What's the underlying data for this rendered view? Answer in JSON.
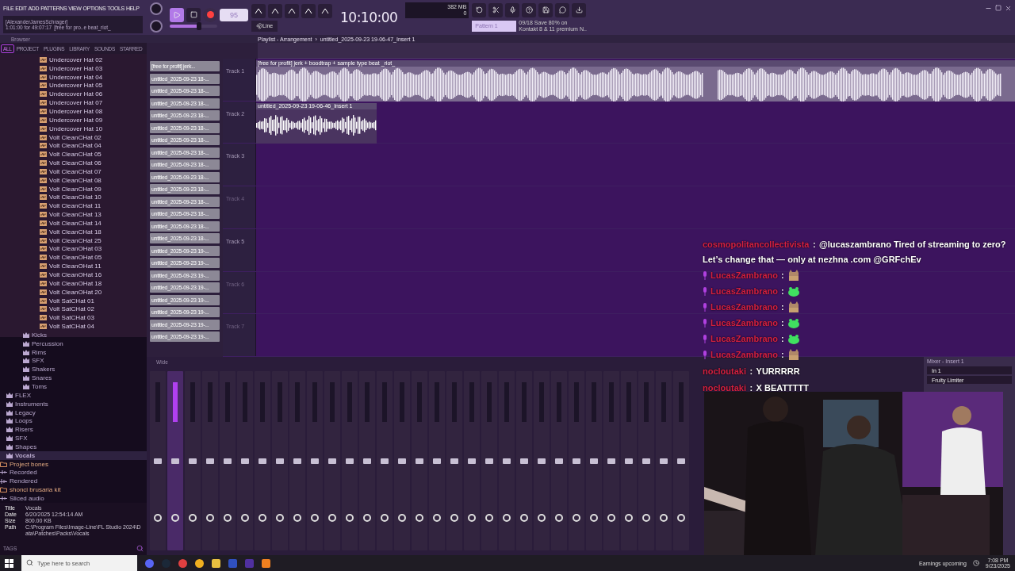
{
  "menu": [
    "FILE",
    "EDIT",
    "ADD",
    "PATTERNS",
    "VIEW",
    "OPTIONS",
    "TOOLS",
    "HELP"
  ],
  "hint": {
    "line1": "[AlexanderJamesSchrager]",
    "line2": "1:01:00 for 49:07:17",
    "line3": "[free for pro..e beat_riot_"
  },
  "transport": {
    "master": {
      "level": 0.62
    },
    "playing": false,
    "recording": true,
    "tempo": "95",
    "time": "10:10:00",
    "memory": "382 MB",
    "cpu": "0",
    "snap": "Line",
    "pattern": "Pattern 1"
  },
  "news": {
    "line1": "09/18  Save 80% on",
    "line2": "Kontakt 8 & 11 premium N.."
  },
  "browser": {
    "title": "Browser",
    "tabs": [
      {
        "label": "ALL",
        "selected": true
      },
      {
        "label": "PROJECT",
        "selected": false
      },
      {
        "label": "PLUGINS",
        "selected": false
      },
      {
        "label": "LIBRARY",
        "selected": false
      },
      {
        "label": "SOUNDS",
        "selected": false
      },
      {
        "label": "STARRED",
        "selected": false
      }
    ],
    "tree": [
      {
        "children": [
          {
            "children": [
              {
                "children": [
                  {
                    "label": "Undercover Hat 02",
                    "kind": "sample"
                  },
                  {
                    "label": "Undercover Hat 03",
                    "kind": "sample"
                  },
                  {
                    "label": "Undercover Hat 04",
                    "kind": "sample"
                  },
                  {
                    "label": "Undercover Hat 05",
                    "kind": "sample"
                  },
                  {
                    "label": "Undercover Hat 06",
                    "kind": "sample"
                  },
                  {
                    "label": "Undercover Hat 07",
                    "kind": "sample"
                  },
                  {
                    "label": "Undercover Hat 08",
                    "kind": "sample"
                  },
                  {
                    "label": "Undercover Hat 09",
                    "kind": "sample"
                  },
                  {
                    "label": "Undercover Hat 10",
                    "kind": "sample"
                  },
                  {
                    "label": "Volt CleanCHat 02",
                    "kind": "sample"
                  },
                  {
                    "label": "Volt CleanCHat 04",
                    "kind": "sample"
                  },
                  {
                    "label": "Volt CleanCHat 05",
                    "kind": "sample"
                  },
                  {
                    "label": "Volt CleanCHat 06",
                    "kind": "sample"
                  },
                  {
                    "label": "Volt CleanCHat 07",
                    "kind": "sample"
                  },
                  {
                    "label": "Volt CleanCHat 08",
                    "kind": "sample"
                  },
                  {
                    "label": "Volt CleanCHat 09",
                    "kind": "sample"
                  },
                  {
                    "label": "Volt CleanCHat 10",
                    "kind": "sample"
                  },
                  {
                    "label": "Volt CleanCHat 11",
                    "kind": "sample"
                  },
                  {
                    "label": "Volt CleanCHat 13",
                    "kind": "sample"
                  },
                  {
                    "label": "Volt CleanCHat 14",
                    "kind": "sample"
                  },
                  {
                    "label": "Volt CleanCHat 18",
                    "kind": "sample"
                  },
                  {
                    "label": "Volt CleanCHat 25",
                    "kind": "sample"
                  },
                  {
                    "label": "Volt CleanOHat 03",
                    "kind": "sample"
                  },
                  {
                    "label": "Volt CleanOHat 05",
                    "kind": "sample"
                  },
                  {
                    "label": "Volt CleanOHat 11",
                    "kind": "sample"
                  },
                  {
                    "label": "Volt CleanOHat 16",
                    "kind": "sample"
                  },
                  {
                    "label": "Volt CleanOHat 18",
                    "kind": "sample"
                  },
                  {
                    "label": "Volt CleanOHat 20",
                    "kind": "sample"
                  },
                  {
                    "label": "Volt SatCHat 01",
                    "kind": "sample"
                  },
                  {
                    "label": "Volt SatCHat 02",
                    "kind": "sample"
                  },
                  {
                    "label": "Volt SatCHat 03",
                    "kind": "sample"
                  },
                  {
                    "label": "Volt SatCHat 04",
                    "kind": "sample"
                  }
                ]
              },
              {
                "label": "Kicks",
                "kind": "pack",
                "selected": false
              },
              {
                "label": "Percussion",
                "kind": "pack",
                "selected": false
              },
              {
                "label": "Rims",
                "kind": "pack",
                "selected": false
              },
              {
                "label": "SFX",
                "kind": "pack",
                "selected": false
              },
              {
                "label": "Shakers",
                "kind": "pack",
                "selected": false
              },
              {
                "label": "Snares",
                "kind": "pack",
                "selected": false
              },
              {
                "label": "Toms",
                "kind": "pack",
                "selected": false
              }
            ]
          },
          {
            "label": "FLEX",
            "kind": "pack",
            "selected": false
          },
          {
            "label": "Instruments",
            "kind": "pack",
            "selected": false
          },
          {
            "label": "Legacy",
            "kind": "pack",
            "selected": false
          },
          {
            "label": "Loops",
            "kind": "pack",
            "selected": false
          },
          {
            "label": "Risers",
            "kind": "pack",
            "selected": false
          },
          {
            "label": "SFX",
            "kind": "pack",
            "selected": false
          },
          {
            "label": "Shapes",
            "kind": "pack",
            "selected": false
          },
          {
            "label": "Vocals",
            "kind": "pack",
            "selected": true
          }
        ]
      },
      {
        "label": "Project bones",
        "kind": "folder",
        "selected": false
      },
      {
        "label": "Recorded",
        "kind": "recorded",
        "selected": false
      },
      {
        "label": "Rendered",
        "kind": "rendered",
        "selected": false
      },
      {
        "label": "shonci brusaria kit",
        "kind": "folder",
        "selected": false
      },
      {
        "label": "Sliced audio",
        "kind": "recorded",
        "selected": false
      }
    ],
    "info": [
      {
        "key": "Title",
        "value": "Vocals"
      },
      {
        "key": "Date",
        "value": "6/20/2025 12:54:14 AM"
      },
      {
        "key": "Size",
        "value": "800.00 KB"
      },
      {
        "key": "Path",
        "value": "C:\\Program Files\\Image-Line\\FL Studio 2024\\Data\\Patches\\Packs\\Vocals"
      }
    ],
    "tags": "TAGS"
  },
  "playlist": {
    "title": "Playlist - Arrangement",
    "separator": "›",
    "subtitle": "untitled_2025-09-23 19-06-47_Insert 1",
    "clips": [
      "[free for profit] jerk...",
      "untitled_2025-09-23 18-...",
      "untitled_2025-09-23 18-...",
      "untitled_2025-09-23 18-...",
      "untitled_2025-09-23 18-...",
      "untitled_2025-09-23 18-...",
      "untitled_2025-09-23 18-...",
      "untitled_2025-09-23 18-...",
      "untitled_2025-09-23 18-...",
      "untitled_2025-09-23 18-...",
      "untitled_2025-09-23 18-...",
      "untitled_2025-09-23 18-...",
      "untitled_2025-09-23 18-...",
      "untitled_2025-09-23 18-...",
      "untitled_2025-09-23 18-...",
      "untitled_2025-09-23 19-...",
      "untitled_2025-09-23 19-...",
      "untitled_2025-09-23 19-...",
      "untitled_2025-09-23 19-...",
      "untitled_2025-09-23 19-...",
      "untitled_2025-09-23 19-...",
      "untitled_2025-09-23 19-...",
      "untitled_2025-09-23 19-..."
    ],
    "tracks": [
      {
        "name": "Track 1",
        "disabled": false,
        "clip": {
          "kind": "long",
          "title": "[free for profit] jerk + boodtrap + sample type beat _riot_"
        }
      },
      {
        "name": "Track 2",
        "disabled": false,
        "clip": {
          "kind": "short",
          "title": "untitled_2025-09-23 19-06-46_Insert 1"
        }
      },
      {
        "name": "Track 3",
        "disabled": false
      },
      {
        "name": "Track 4",
        "disabled": true
      },
      {
        "name": "Track 5",
        "disabled": false
      },
      {
        "name": "Track 6",
        "disabled": true
      },
      {
        "name": "Track 7",
        "disabled": true
      }
    ]
  },
  "mixer": {
    "view": "Wide",
    "strips": [
      {
        "selected": false
      },
      {
        "selected": true
      },
      {
        "selected": false
      },
      {
        "selected": false
      },
      {
        "selected": false
      },
      {
        "selected": false
      },
      {
        "selected": false
      },
      {
        "selected": false
      },
      {
        "selected": false
      },
      {
        "selected": false
      },
      {
        "selected": false
      },
      {
        "selected": false
      },
      {
        "selected": false
      },
      {
        "selected": false
      },
      {
        "selected": false
      },
      {
        "selected": false
      },
      {
        "selected": false
      },
      {
        "selected": false
      },
      {
        "selected": false
      },
      {
        "selected": false
      },
      {
        "selected": false
      },
      {
        "selected": false
      },
      {
        "selected": false
      },
      {
        "selected": false
      },
      {
        "selected": false
      },
      {
        "selected": false
      },
      {
        "selected": false
      },
      {
        "selected": false
      },
      {
        "selected": false
      },
      {
        "selected": false
      },
      {
        "selected": false
      }
    ]
  },
  "insert_panel": {
    "title": "Mixer - Insert 1",
    "input": "In 1",
    "effect": "Fruity Limiter"
  },
  "chat": [
    {
      "user": "cosmopolitancollectivista",
      "separator": ":",
      "kind": "text",
      "badge": false,
      "text": "@lucaszambrano Tired of streaming to zero? Let’s change that — only at nezhna .com @GRFchEv"
    },
    {
      "user": "LucasZambrano",
      "separator": ":",
      "kind": "emote",
      "badge": true,
      "emote": {
        "kind": "cat"
      }
    },
    {
      "user": "LucasZambrano",
      "separator": ":",
      "kind": "emote",
      "badge": true,
      "emote": {
        "kind": "blob"
      }
    },
    {
      "user": "LucasZambrano",
      "separator": ":",
      "kind": "emote",
      "badge": true,
      "emote": {
        "kind": "cat"
      }
    },
    {
      "user": "LucasZambrano",
      "separator": ":",
      "kind": "emote",
      "badge": true,
      "emote": {
        "kind": "blob"
      }
    },
    {
      "user": "LucasZambrano",
      "separator": ":",
      "kind": "emote",
      "badge": true,
      "emote": {
        "kind": "blob"
      }
    },
    {
      "user": "LucasZambrano",
      "separator": ":",
      "kind": "emote",
      "badge": true,
      "emote": {
        "kind": "cat"
      }
    },
    {
      "user": "nocloutaki",
      "separator": ":",
      "kind": "text",
      "badge": false,
      "text": "YURRRRR"
    },
    {
      "user": "nocloutaki",
      "separator": ":",
      "kind": "text",
      "badge": false,
      "text": "X BEATTTTT"
    }
  ],
  "taskbar": {
    "search_placeholder": "Type here to search",
    "news": "Earnings upcoming",
    "time": "7:08 PM",
    "date": "9/23/2025"
  }
}
